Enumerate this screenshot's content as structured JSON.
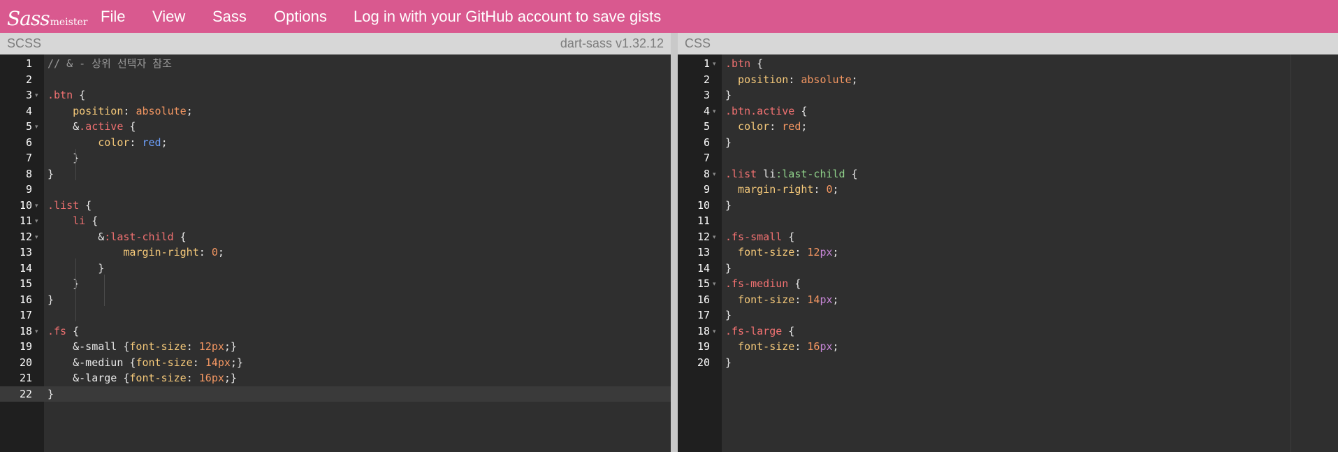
{
  "app": {
    "logo_script": "Sass",
    "logo_text": "meister"
  },
  "menu": [
    {
      "label": "File"
    },
    {
      "label": "View"
    },
    {
      "label": "Sass"
    },
    {
      "label": "Options"
    },
    {
      "label": "Log in with your GitHub account to save gists"
    }
  ],
  "scss_pane": {
    "title": "SCSS",
    "compiler": "dart-sass v1.32.12",
    "active_line": 22,
    "lines": [
      {
        "n": "1",
        "fold": false,
        "tokens": [
          {
            "t": "// & - 상위 선택자 참조",
            "c": "cm"
          }
        ]
      },
      {
        "n": "2",
        "fold": false,
        "tokens": []
      },
      {
        "n": "3",
        "fold": true,
        "tokens": [
          {
            "t": ".btn",
            "c": "sel"
          },
          {
            "t": " {",
            "c": "pun"
          }
        ]
      },
      {
        "n": "4",
        "fold": false,
        "tokens": [
          {
            "t": "    position",
            "c": "prop"
          },
          {
            "t": ": ",
            "c": "pun"
          },
          {
            "t": "absolute",
            "c": "val"
          },
          {
            "t": ";",
            "c": "pun"
          }
        ]
      },
      {
        "n": "5",
        "fold": true,
        "tokens": [
          {
            "t": "    &",
            "c": "amp"
          },
          {
            "t": ".active",
            "c": "sel"
          },
          {
            "t": " {",
            "c": "pun"
          }
        ]
      },
      {
        "n": "6",
        "fold": false,
        "tokens": [
          {
            "t": "        color",
            "c": "prop"
          },
          {
            "t": ": ",
            "c": "pun"
          },
          {
            "t": "red",
            "c": "kw"
          },
          {
            "t": ";",
            "c": "pun"
          }
        ]
      },
      {
        "n": "7",
        "fold": false,
        "tokens": [
          {
            "t": "    }",
            "c": "pun"
          }
        ]
      },
      {
        "n": "8",
        "fold": false,
        "tokens": [
          {
            "t": "}",
            "c": "pun"
          }
        ]
      },
      {
        "n": "9",
        "fold": false,
        "tokens": []
      },
      {
        "n": "10",
        "fold": true,
        "tokens": [
          {
            "t": ".list",
            "c": "sel"
          },
          {
            "t": " {",
            "c": "pun"
          }
        ]
      },
      {
        "n": "11",
        "fold": true,
        "tokens": [
          {
            "t": "    li",
            "c": "sel"
          },
          {
            "t": " {",
            "c": "pun"
          }
        ]
      },
      {
        "n": "12",
        "fold": true,
        "tokens": [
          {
            "t": "        &",
            "c": "amp"
          },
          {
            "t": ":last-child",
            "c": "sel"
          },
          {
            "t": " {",
            "c": "pun"
          }
        ]
      },
      {
        "n": "13",
        "fold": false,
        "tokens": [
          {
            "t": "            margin-right",
            "c": "prop"
          },
          {
            "t": ": ",
            "c": "pun"
          },
          {
            "t": "0",
            "c": "num"
          },
          {
            "t": ";",
            "c": "pun"
          }
        ]
      },
      {
        "n": "14",
        "fold": false,
        "tokens": [
          {
            "t": "        }",
            "c": "pun"
          }
        ]
      },
      {
        "n": "15",
        "fold": false,
        "tokens": [
          {
            "t": "    }",
            "c": "pun"
          }
        ]
      },
      {
        "n": "16",
        "fold": false,
        "tokens": [
          {
            "t": "}",
            "c": "pun"
          }
        ]
      },
      {
        "n": "17",
        "fold": false,
        "tokens": []
      },
      {
        "n": "18",
        "fold": true,
        "tokens": [
          {
            "t": ".fs",
            "c": "sel"
          },
          {
            "t": " {",
            "c": "pun"
          }
        ]
      },
      {
        "n": "19",
        "fold": false,
        "tokens": [
          {
            "t": "    &-small {",
            "c": "amp"
          },
          {
            "t": "font-size",
            "c": "prop"
          },
          {
            "t": ": ",
            "c": "pun"
          },
          {
            "t": "12",
            "c": "num"
          },
          {
            "t": "px",
            "c": "val"
          },
          {
            "t": ";}",
            "c": "pun"
          }
        ]
      },
      {
        "n": "20",
        "fold": false,
        "tokens": [
          {
            "t": "    &-mediun {",
            "c": "amp"
          },
          {
            "t": "font-size",
            "c": "prop"
          },
          {
            "t": ": ",
            "c": "pun"
          },
          {
            "t": "14",
            "c": "num"
          },
          {
            "t": "px",
            "c": "val"
          },
          {
            "t": ";}",
            "c": "pun"
          }
        ]
      },
      {
        "n": "21",
        "fold": false,
        "tokens": [
          {
            "t": "    &-large {",
            "c": "amp"
          },
          {
            "t": "font-size",
            "c": "prop"
          },
          {
            "t": ": ",
            "c": "pun"
          },
          {
            "t": "16",
            "c": "num"
          },
          {
            "t": "px",
            "c": "val"
          },
          {
            "t": ";}",
            "c": "pun"
          }
        ]
      },
      {
        "n": "22",
        "fold": false,
        "tokens": [
          {
            "t": "}",
            "c": "pun"
          }
        ]
      }
    ]
  },
  "css_pane": {
    "title": "CSS",
    "lines": [
      {
        "n": "1",
        "fold": true,
        "tokens": [
          {
            "t": ".btn",
            "c": "sel"
          },
          {
            "t": " {",
            "c": "pun"
          }
        ]
      },
      {
        "n": "2",
        "fold": false,
        "tokens": [
          {
            "t": "  position",
            "c": "prop"
          },
          {
            "t": ": ",
            "c": "pun"
          },
          {
            "t": "absolute",
            "c": "val"
          },
          {
            "t": ";",
            "c": "pun"
          }
        ]
      },
      {
        "n": "3",
        "fold": false,
        "tokens": [
          {
            "t": "}",
            "c": "pun"
          }
        ]
      },
      {
        "n": "4",
        "fold": true,
        "tokens": [
          {
            "t": ".btn.active",
            "c": "sel"
          },
          {
            "t": " {",
            "c": "pun"
          }
        ]
      },
      {
        "n": "5",
        "fold": false,
        "tokens": [
          {
            "t": "  color",
            "c": "prop"
          },
          {
            "t": ": ",
            "c": "pun"
          },
          {
            "t": "red",
            "c": "val"
          },
          {
            "t": ";",
            "c": "pun"
          }
        ]
      },
      {
        "n": "6",
        "fold": false,
        "tokens": [
          {
            "t": "}",
            "c": "pun"
          }
        ]
      },
      {
        "n": "7",
        "fold": false,
        "tokens": []
      },
      {
        "n": "8",
        "fold": true,
        "tokens": [
          {
            "t": ".list",
            "c": "sel"
          },
          {
            "t": " li",
            "c": "pun"
          },
          {
            "t": ":last-child",
            "c": "pseudo"
          },
          {
            "t": " {",
            "c": "pun"
          }
        ]
      },
      {
        "n": "9",
        "fold": false,
        "tokens": [
          {
            "t": "  margin-right",
            "c": "prop"
          },
          {
            "t": ": ",
            "c": "pun"
          },
          {
            "t": "0",
            "c": "num"
          },
          {
            "t": ";",
            "c": "pun"
          }
        ]
      },
      {
        "n": "10",
        "fold": false,
        "tokens": [
          {
            "t": "}",
            "c": "pun"
          }
        ]
      },
      {
        "n": "11",
        "fold": false,
        "tokens": []
      },
      {
        "n": "12",
        "fold": true,
        "tokens": [
          {
            "t": ".fs-small",
            "c": "sel"
          },
          {
            "t": " {",
            "c": "pun"
          }
        ]
      },
      {
        "n": "13",
        "fold": false,
        "tokens": [
          {
            "t": "  font-size",
            "c": "prop"
          },
          {
            "t": ": ",
            "c": "pun"
          },
          {
            "t": "12",
            "c": "num"
          },
          {
            "t": "px",
            "c": "unit"
          },
          {
            "t": ";",
            "c": "pun"
          }
        ]
      },
      {
        "n": "14",
        "fold": false,
        "tokens": [
          {
            "t": "}",
            "c": "pun"
          }
        ]
      },
      {
        "n": "15",
        "fold": true,
        "tokens": [
          {
            "t": ".fs-mediun",
            "c": "sel"
          },
          {
            "t": " {",
            "c": "pun"
          }
        ]
      },
      {
        "n": "16",
        "fold": false,
        "tokens": [
          {
            "t": "  font-size",
            "c": "prop"
          },
          {
            "t": ": ",
            "c": "pun"
          },
          {
            "t": "14",
            "c": "num"
          },
          {
            "t": "px",
            "c": "unit"
          },
          {
            "t": ";",
            "c": "pun"
          }
        ]
      },
      {
        "n": "17",
        "fold": false,
        "tokens": [
          {
            "t": "}",
            "c": "pun"
          }
        ]
      },
      {
        "n": "18",
        "fold": true,
        "tokens": [
          {
            "t": ".fs-large",
            "c": "sel"
          },
          {
            "t": " {",
            "c": "pun"
          }
        ]
      },
      {
        "n": "19",
        "fold": false,
        "tokens": [
          {
            "t": "  font-size",
            "c": "prop"
          },
          {
            "t": ": ",
            "c": "pun"
          },
          {
            "t": "16",
            "c": "num"
          },
          {
            "t": "px",
            "c": "unit"
          },
          {
            "t": ";",
            "c": "pun"
          }
        ]
      },
      {
        "n": "20",
        "fold": false,
        "tokens": [
          {
            "t": "}",
            "c": "pun"
          }
        ]
      }
    ]
  },
  "colors": {
    "brand": "#d9598f",
    "header_bg": "#d7d7d7",
    "editor_bg": "#2f2f2f"
  }
}
